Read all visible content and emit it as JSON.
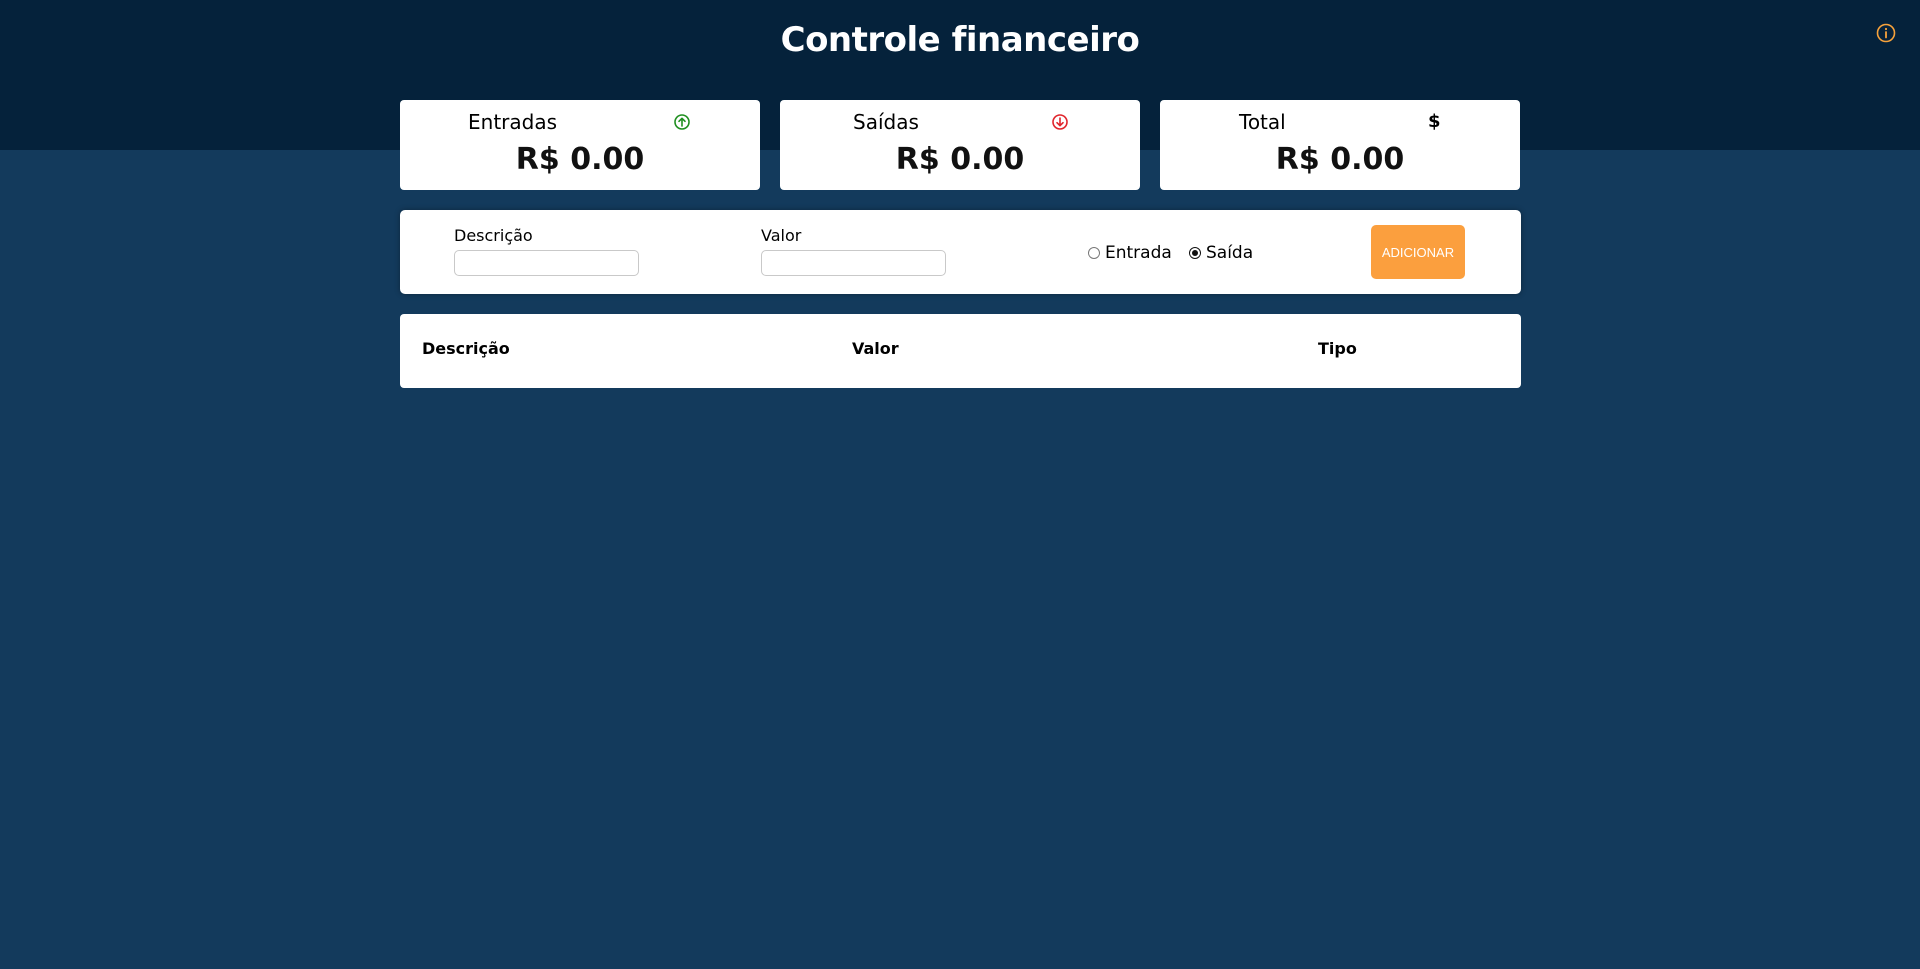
{
  "header": {
    "title": "Controle financeiro",
    "info_icon": "info-circle-icon",
    "info_icon_color": "#f7a23b"
  },
  "summary": {
    "income": {
      "title": "Entradas",
      "value": "R$ 0.00",
      "icon": "arrow-up-circle-icon",
      "icon_color": "#1f8f1f"
    },
    "expense": {
      "title": "Saídas",
      "value": "R$ 0.00",
      "icon": "arrow-down-circle-icon",
      "icon_color": "#e0242b"
    },
    "total": {
      "title": "Total",
      "value": "R$ 0.00",
      "icon": "dollar-icon"
    }
  },
  "form": {
    "description_label": "Descrição",
    "description_value": "",
    "value_label": "Valor",
    "value_value": "",
    "type_options": [
      {
        "label": "Entrada",
        "checked": false
      },
      {
        "label": "Saída",
        "checked": true
      }
    ],
    "add_button_label": "ADICIONAR",
    "accent_color": "#fb9f3e"
  },
  "table": {
    "columns": [
      "Descrição",
      "Valor",
      "Tipo"
    ],
    "rows": []
  },
  "colors": {
    "header_bg": "#05223b",
    "page_bg": "#133a5c"
  }
}
